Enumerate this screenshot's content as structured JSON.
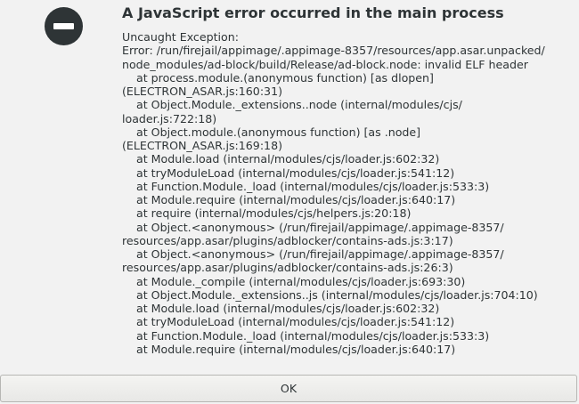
{
  "dialog": {
    "icon": "error-icon",
    "title": "A JavaScript error occurred in the main process",
    "message_lines": [
      "Uncaught Exception:",
      "Error: /run/firejail/appimage/.appimage-8357/resources/app.asar.unpacked/",
      "node_modules/ad-block/build/Release/ad-block.node: invalid ELF header",
      "    at process.module.(anonymous function) [as dlopen]",
      "(ELECTRON_ASAR.js:160:31)",
      "    at Object.Module._extensions..node (internal/modules/cjs/",
      "loader.js:722:18)",
      "    at Object.module.(anonymous function) [as .node]",
      "(ELECTRON_ASAR.js:169:18)",
      "    at Module.load (internal/modules/cjs/loader.js:602:32)",
      "    at tryModuleLoad (internal/modules/cjs/loader.js:541:12)",
      "    at Function.Module._load (internal/modules/cjs/loader.js:533:3)",
      "    at Module.require (internal/modules/cjs/loader.js:640:17)",
      "    at require (internal/modules/cjs/helpers.js:20:18)",
      "    at Object.<anonymous> (/run/firejail/appimage/.appimage-8357/",
      "resources/app.asar/plugins/adblocker/contains-ads.js:3:17)",
      "    at Object.<anonymous> (/run/firejail/appimage/.appimage-8357/",
      "resources/app.asar/plugins/adblocker/contains-ads.js:26:3)",
      "    at Module._compile (internal/modules/cjs/loader.js:693:30)",
      "    at Object.Module._extensions..js (internal/modules/cjs/loader.js:704:10)",
      "    at Module.load (internal/modules/cjs/loader.js:602:32)",
      "    at tryModuleLoad (internal/modules/cjs/loader.js:541:12)",
      "    at Function.Module._load (internal/modules/cjs/loader.js:533:3)",
      "    at Module.require (internal/modules/cjs/loader.js:640:17)"
    ],
    "ok_label": "OK"
  },
  "colors": {
    "background": "#f2f2f2",
    "text": "#2e3436",
    "icon": "#2e3436"
  }
}
